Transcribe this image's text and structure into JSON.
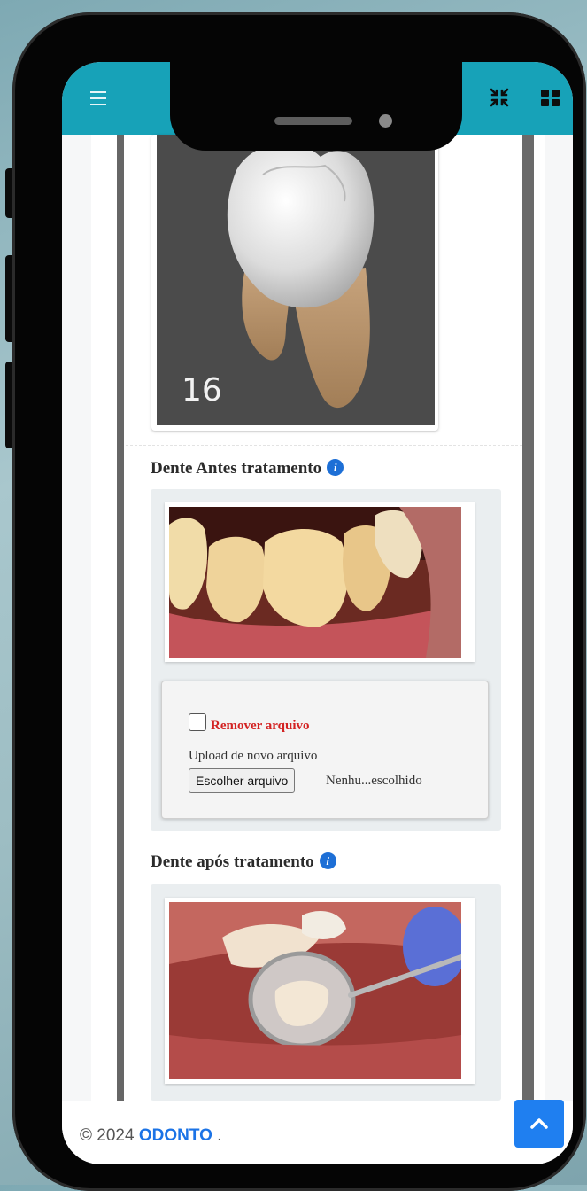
{
  "tooth_card": {
    "number": "16"
  },
  "before": {
    "title": "Dente Antes tratamento",
    "info_icon": "info-circle-icon",
    "remove_label": "Remover arquivo",
    "upload_label": "Upload de novo arquivo",
    "choose_button": "Escolher arquivo",
    "file_status": "Nenhu...escolhido"
  },
  "after": {
    "title": "Dente após tratamento",
    "info_icon": "info-circle-icon"
  },
  "footer": {
    "copyright": "© 2024",
    "brand": "ODONTO",
    "suffix": "."
  },
  "colors": {
    "header": "#17a2b8",
    "accent": "#1f7ff0",
    "danger": "#d32222"
  }
}
